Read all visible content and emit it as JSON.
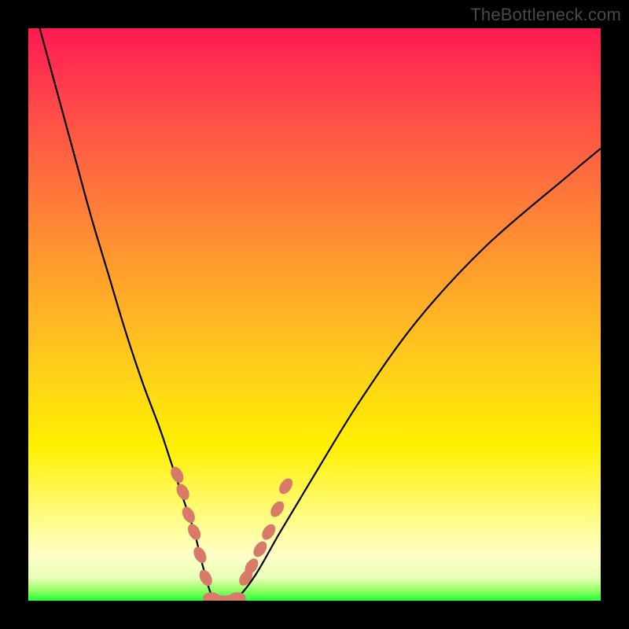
{
  "watermark": "TheBottleneck.com",
  "colors": {
    "background": "#000000",
    "curve": "#000000",
    "marker": "#d87a6a",
    "gradient_top": "#ff1a52",
    "gradient_mid": "#ffd01a",
    "gradient_bottom": "#27ff3a"
  },
  "chart_data": {
    "type": "line",
    "title": "",
    "xlabel": "",
    "ylabel": "",
    "xlim": [
      0,
      100
    ],
    "ylim": [
      0,
      100
    ],
    "grid": false,
    "legend": false,
    "series": [
      {
        "name": "bottleneck-curve",
        "x": [
          2,
          5,
          8,
          11,
          14,
          17,
          20,
          23,
          25,
          27,
          29,
          30.5,
          32,
          33.5,
          35,
          37,
          40,
          44,
          50,
          58,
          68,
          80,
          94,
          100
        ],
        "values": [
          100,
          89,
          78,
          67,
          57,
          47,
          38,
          30,
          24,
          18,
          12,
          6,
          1,
          0,
          0,
          1,
          5,
          12,
          22,
          35,
          49,
          62,
          74,
          79
        ]
      }
    ],
    "markers": {
      "name": "highlighted-points",
      "left_branch": [
        {
          "x": 26,
          "y": 22
        },
        {
          "x": 27,
          "y": 19
        },
        {
          "x": 28,
          "y": 15
        },
        {
          "x": 29,
          "y": 12
        },
        {
          "x": 30,
          "y": 8
        },
        {
          "x": 31,
          "y": 4
        }
      ],
      "right_branch": [
        {
          "x": 38,
          "y": 4
        },
        {
          "x": 39,
          "y": 6
        },
        {
          "x": 40.5,
          "y": 9
        },
        {
          "x": 42,
          "y": 12
        },
        {
          "x": 43.5,
          "y": 16
        },
        {
          "x": 45,
          "y": 20
        }
      ],
      "bottom_flat": [
        {
          "x": 32,
          "y": 0.5
        },
        {
          "x": 33.5,
          "y": 0
        },
        {
          "x": 35,
          "y": 0
        },
        {
          "x": 36.5,
          "y": 0.5
        }
      ]
    }
  }
}
